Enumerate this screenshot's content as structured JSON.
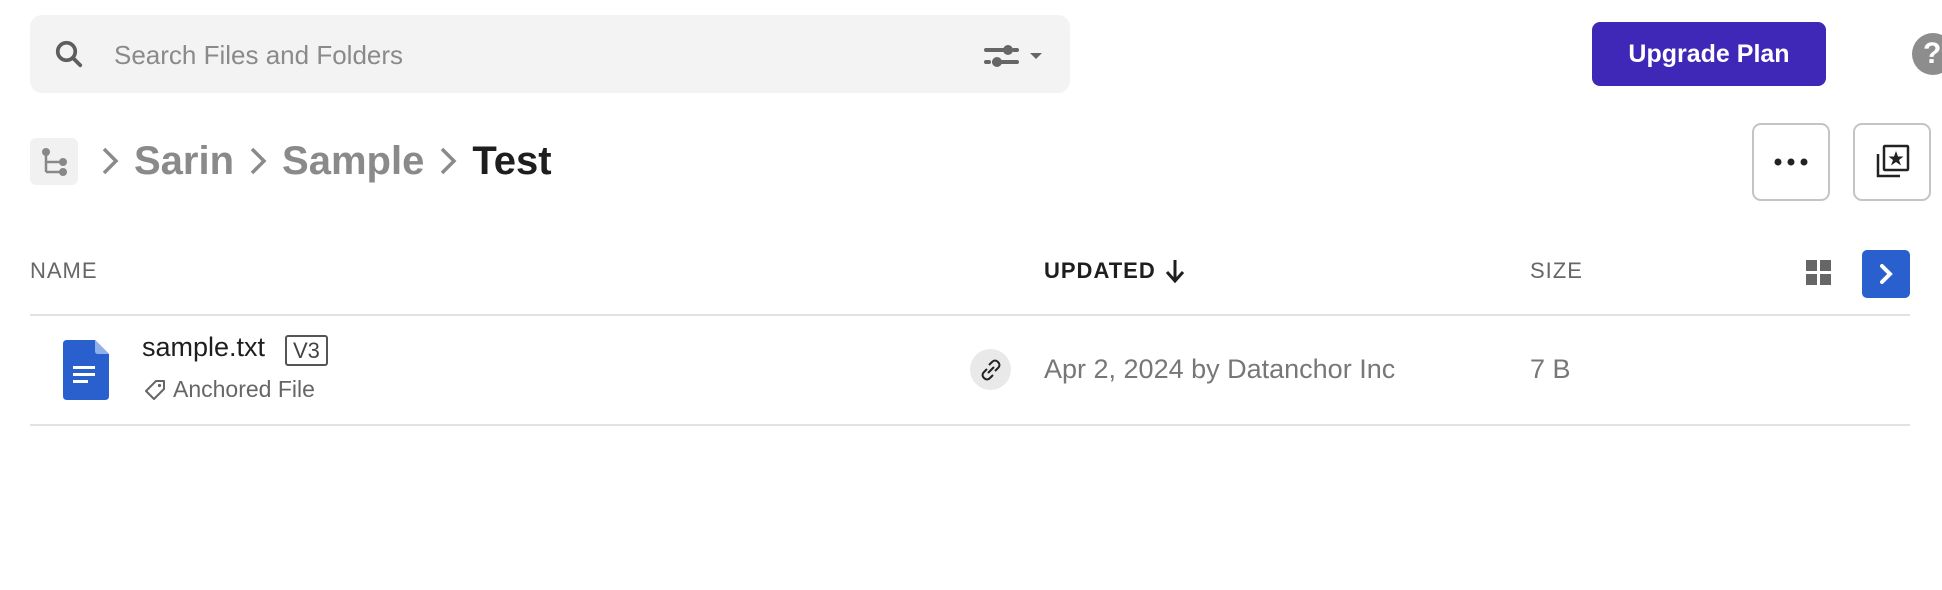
{
  "search": {
    "placeholder": "Search Files and Folders",
    "value": "",
    "icon": "search-icon",
    "filter_icon": "sliders-icon"
  },
  "header": {
    "upgrade_label": "Upgrade Plan",
    "upgrade_color": "#3f27b8",
    "help_glyph": "?"
  },
  "breadcrumb": {
    "root_icon": "folder-tree-icon",
    "items": [
      {
        "label": "Sarin",
        "current": false
      },
      {
        "label": "Sample",
        "current": false
      },
      {
        "label": "Test",
        "current": true
      }
    ]
  },
  "actions": {
    "more_icon": "more-horizontal-icon",
    "favorites_icon": "star-collection-icon"
  },
  "table": {
    "columns": [
      {
        "label": "NAME"
      },
      {
        "label": "UPDATED",
        "sorted": "desc"
      },
      {
        "label": "SIZE"
      }
    ],
    "accent_color": "#2a5fce",
    "rows": [
      {
        "name": "sample.txt",
        "version": "V3",
        "tag": "Anchored File",
        "updated": "Apr 2, 2024 by Datanchor Inc",
        "size": "7 B",
        "file_type_icon": "document-icon"
      }
    ]
  }
}
